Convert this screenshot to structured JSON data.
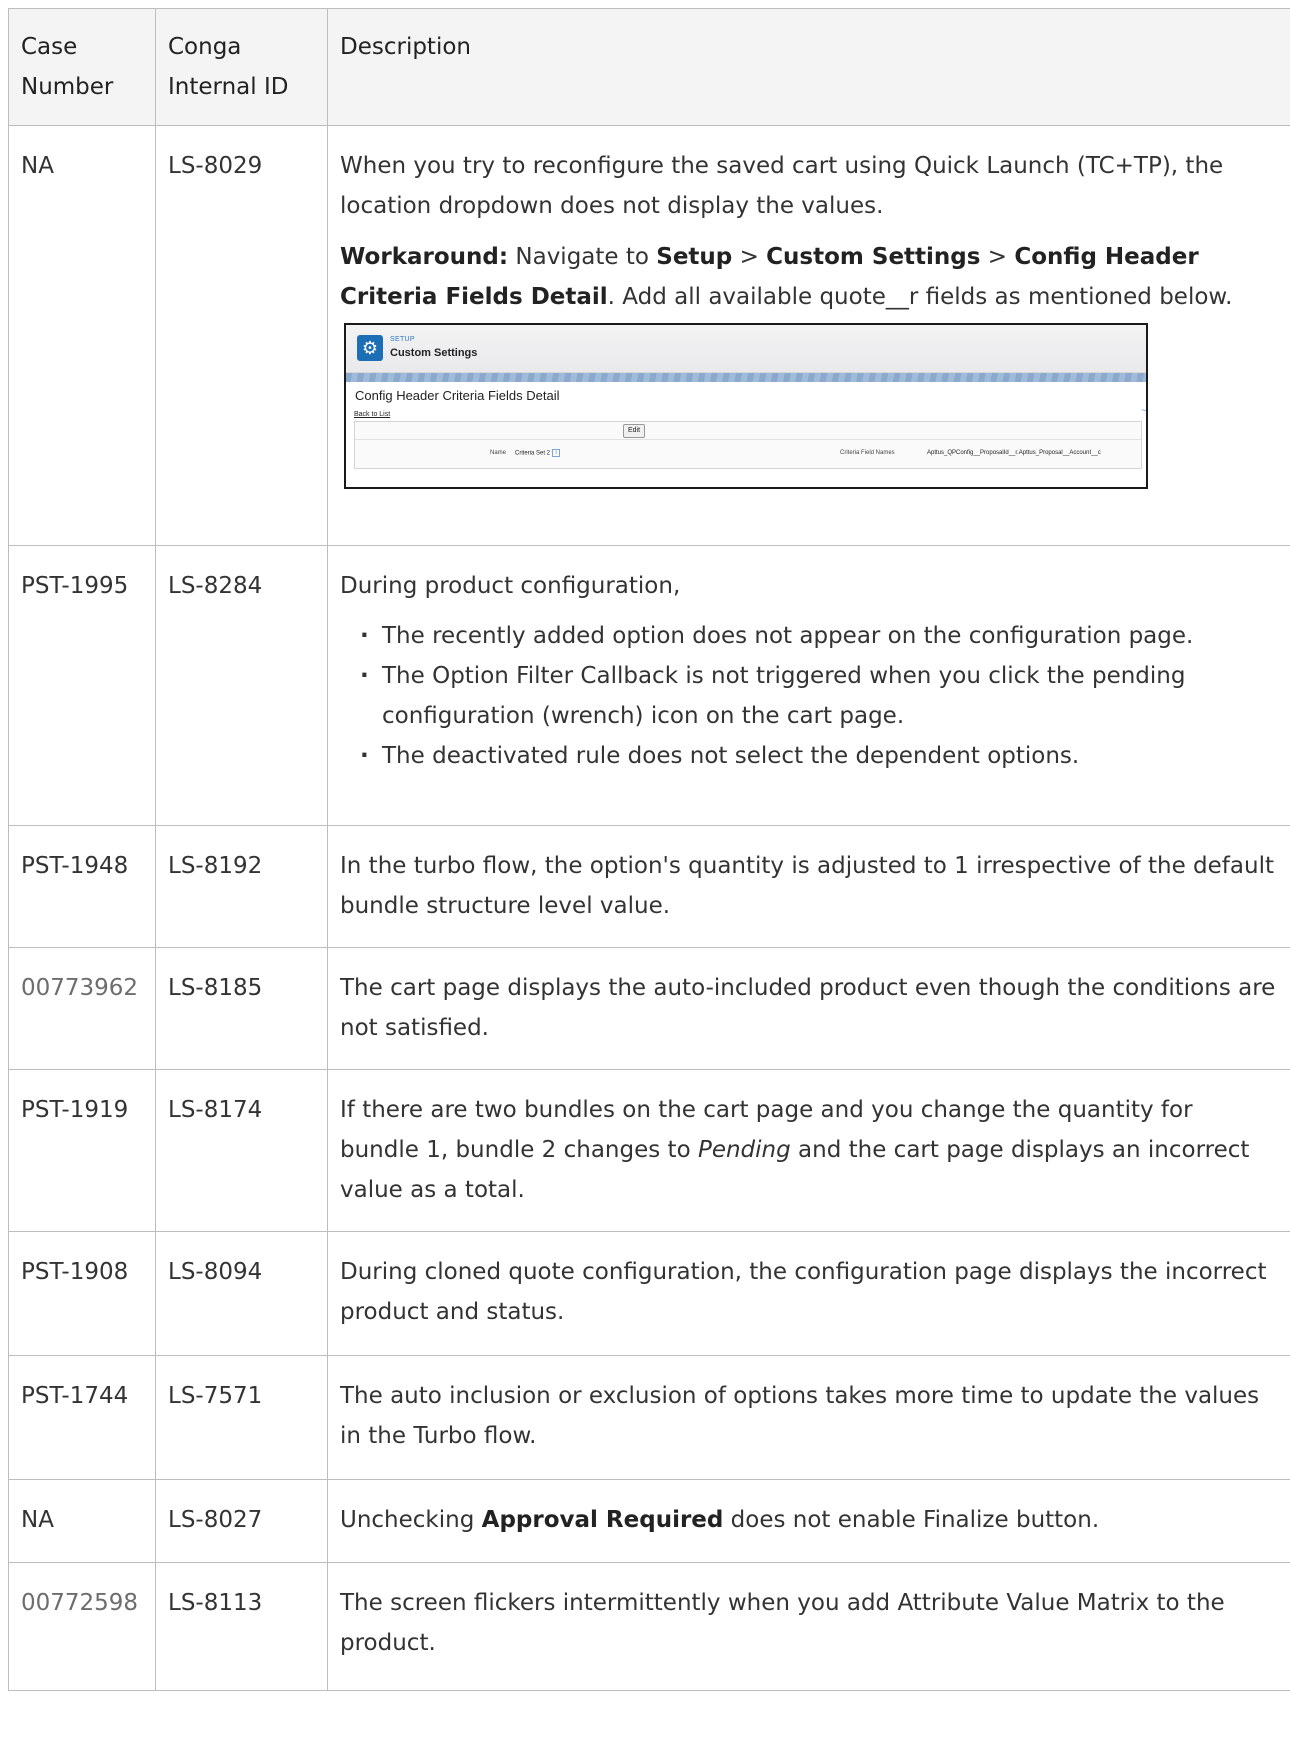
{
  "table": {
    "headers": {
      "case_line1": "Case",
      "case_line2": "Number",
      "id_line1": "Conga",
      "id_line2": "Internal ID",
      "description": "Description"
    },
    "rows": [
      {
        "case": "NA",
        "id": "LS-8029",
        "text1": "When you try to reconfigure the saved cart using Quick Launch (TC+TP), the location dropdown does not display the values.",
        "workaround_label": "Workaround:",
        "wa_text_a": " Navigate to ",
        "wa_setup": "Setup",
        "wa_sep1": " > ",
        "wa_custom_settings": "Custom Settings",
        "wa_sep2": " > ",
        "wa_detail": "Config Header Criteria Fields Detail",
        "wa_text_b": ". Add all available quote__r fields as mentioned below.",
        "screenshot": {
          "setup_label": "SETUP",
          "header_title": "Custom Settings",
          "page_title": "Config Header Criteria Fields Detail",
          "back_link": "Back to List",
          "edit_button": "Edit",
          "name_label": "Name",
          "name_value": "Criteria Set 2",
          "criteria_label": "Criteria Field Names",
          "criteria_value": "Apttus_QPConfig__ProposalId__r.Apttus_Proposal__Account__c"
        }
      },
      {
        "case": "PST-1995",
        "id": "LS-8284",
        "intro": "During product configuration,",
        "bullets": [
          "The recently added option does not appear on the configuration page.",
          "The Option Filter Callback is not triggered when you click the pending configuration (wrench) icon on the cart page.",
          "The deactivated rule does not select the dependent options."
        ]
      },
      {
        "case": "PST-1948",
        "id": "LS-8192",
        "text": "In the turbo flow, the option's quantity is adjusted to 1 irrespective of the default bundle structure level value."
      },
      {
        "case": "00773962",
        "id": "LS-8185",
        "text": "The cart page displays the auto-included product even though the conditions are not satisfied."
      },
      {
        "case": "PST-1919",
        "id": "LS-8174",
        "text_a": "If there are two bundles on the cart page and you change the quantity for bundle 1, bundle 2 changes to ",
        "text_em": "Pending",
        "text_b": " and the cart page displays an incorrect value as a total."
      },
      {
        "case": "PST-1908",
        "id": "LS-8094",
        "text": "During cloned quote configuration, the configuration page displays the incorrect product and status."
      },
      {
        "case": "PST-1744",
        "id": "LS-7571",
        "text": "The auto inclusion or exclusion of options takes more time to update the values in the Turbo flow."
      },
      {
        "case": "NA",
        "id": "LS-8027",
        "text_a": "Unchecking ",
        "text_bold": "Approval Required",
        "text_b": " does not enable Finalize button."
      },
      {
        "case": "00772598",
        "id": "LS-8113",
        "text": "The screen flickers intermittently when you add Attribute Value Matrix to the product."
      }
    ]
  }
}
